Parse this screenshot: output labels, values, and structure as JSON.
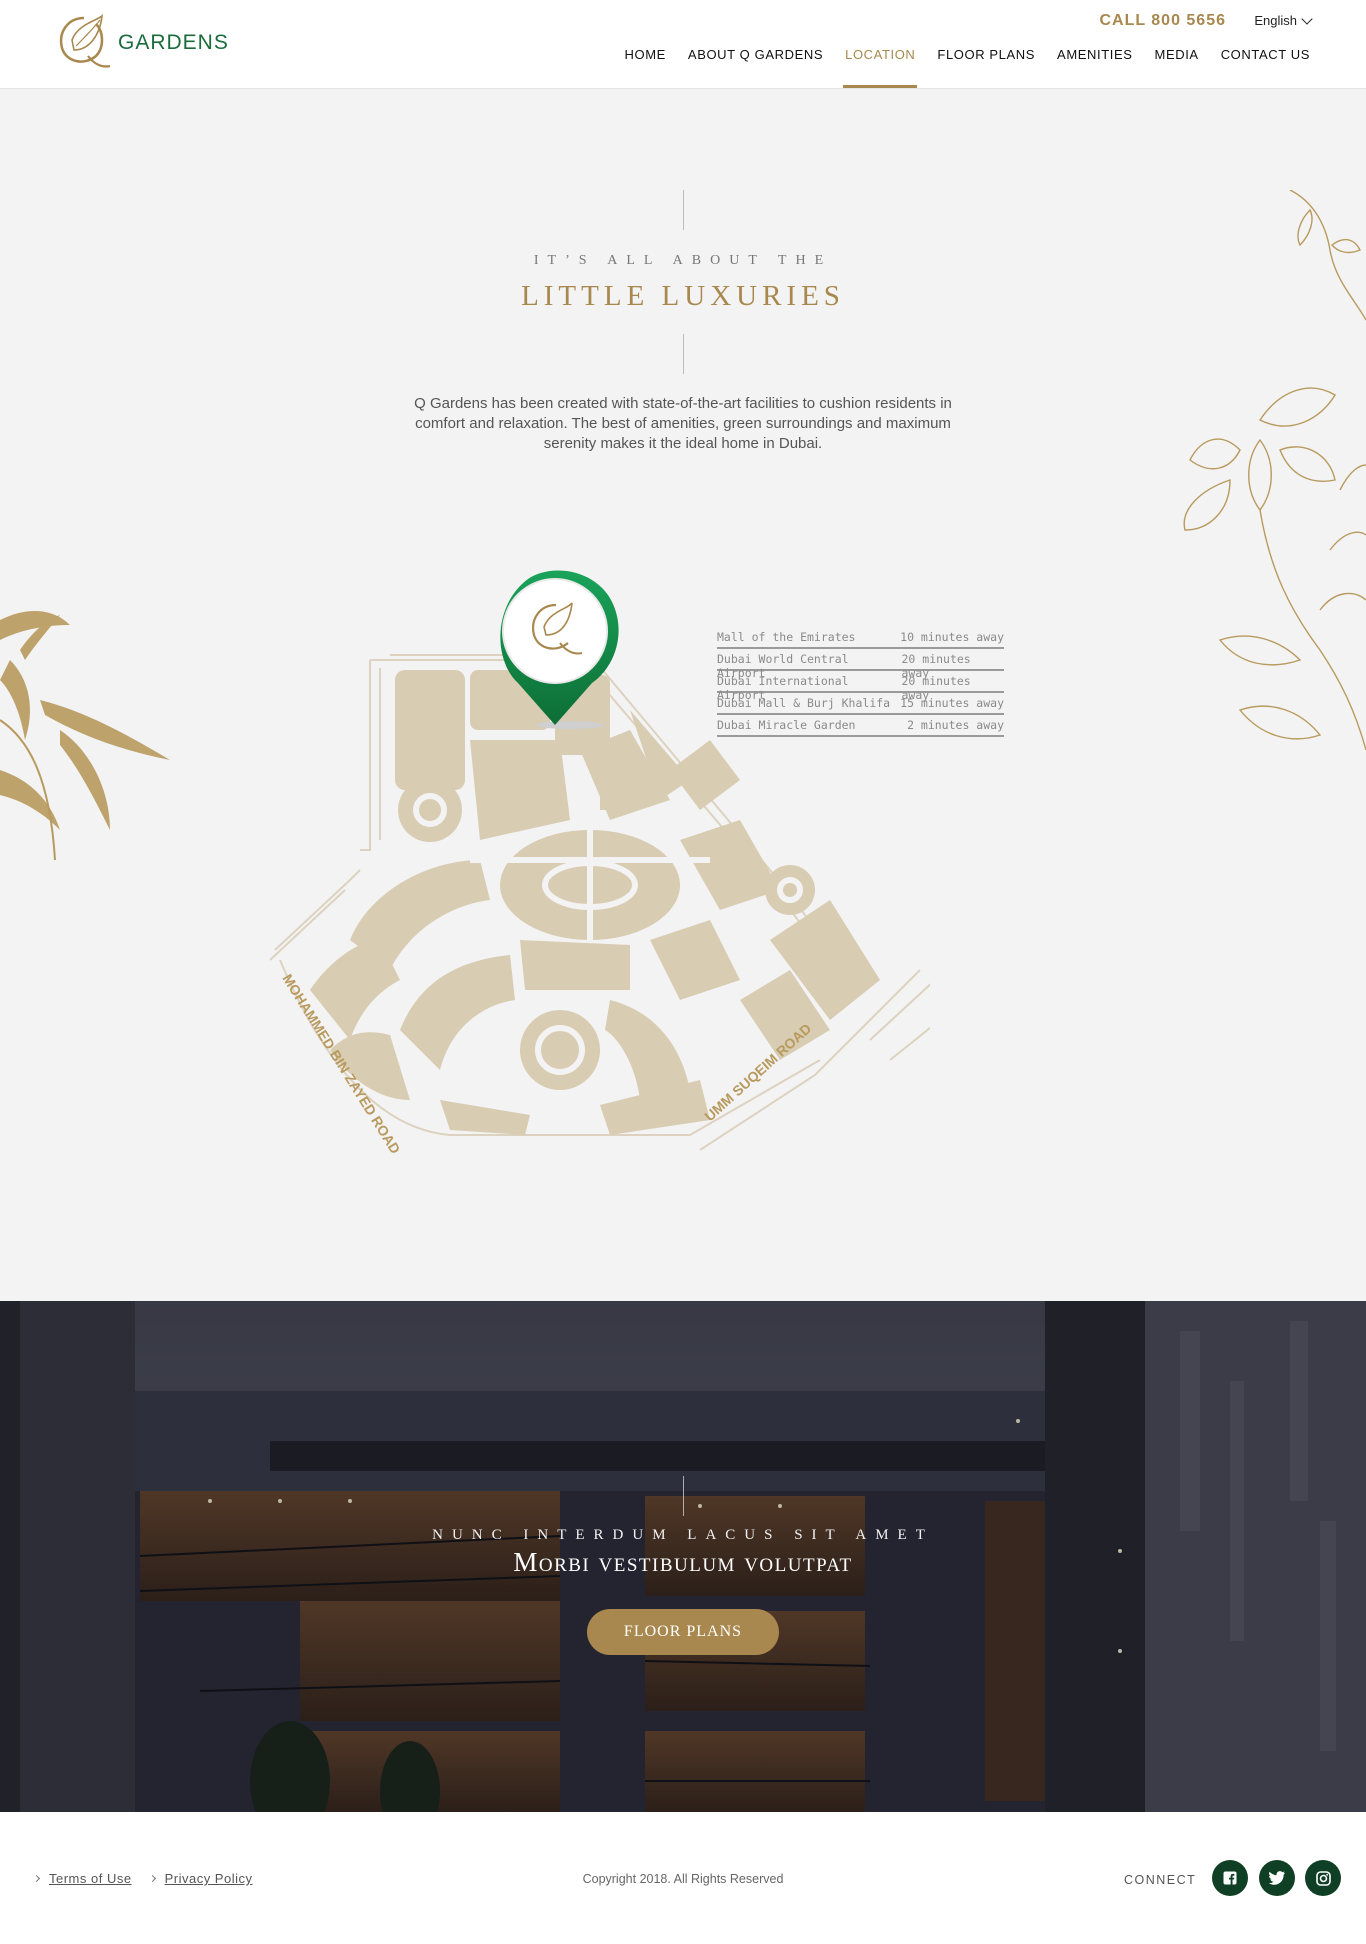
{
  "header": {
    "logo_text": "GARDENS",
    "call": "CALL 800 5656",
    "language": "English",
    "nav": [
      "HOME",
      "ABOUT Q GARDENS",
      "LOCATION",
      "FLOOR PLANS",
      "AMENITIES",
      "MEDIA",
      "CONTACT US"
    ],
    "active_nav": "LOCATION"
  },
  "intro": {
    "kicker": "IT’S ALL ABOUT THE",
    "title": "LITTLE LUXURIES",
    "text": "Q Gardens has been created with state-of-the-art facilities to cushion residents in comfort and relaxation. The best of amenities, green surroundings and maximum serenity makes it the ideal home in Dubai."
  },
  "map": {
    "road_left": "MOHAMMED BIN ZAYED ROAD",
    "road_right": "UMM SUQEIM ROAD",
    "distances": [
      {
        "place": "Mall of the Emirates",
        "time": "10 minutes away"
      },
      {
        "place": "Dubai World Central Airport",
        "time": "20 minutes away"
      },
      {
        "place": "Dubai International Airport",
        "time": "20 minutes away"
      },
      {
        "place": "Dubai Mall & Burj Khalifa",
        "time": "15 minutes away"
      },
      {
        "place": "Dubai Miracle Garden",
        "time": "2 minutes away"
      }
    ]
  },
  "hero": {
    "kicker": "NUNC INTERDUM LACUS SIT AMET",
    "title": "Morbi vestibulum volutpat",
    "button": "FLOOR PLANS"
  },
  "footer": {
    "links": [
      "Terms of Use",
      "Privacy Policy"
    ],
    "copyright": "Copyright 2018. All Rights Reserved",
    "connect": "CONNECT",
    "social": [
      "facebook-icon",
      "twitter-icon",
      "instagram-icon"
    ]
  },
  "colors": {
    "gold": "#a8884e",
    "green": "#1b6b3d",
    "dark_green": "#0f3f25",
    "map_fill": "#d8ccb2"
  }
}
